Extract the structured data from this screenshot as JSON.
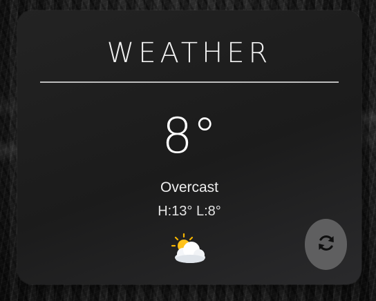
{
  "widget": {
    "title": "WEATHER",
    "temperature": "8°",
    "condition": "Overcast",
    "high_low": "H:13° L:8°",
    "condition_icon": "sun-behind-cloud-icon",
    "refresh_icon": "refresh-icon"
  },
  "colors": {
    "card_background": "#1e1e1e",
    "text": "#ffffff",
    "divider": "#bdbdbd",
    "refresh_button": "#5f5f60"
  }
}
